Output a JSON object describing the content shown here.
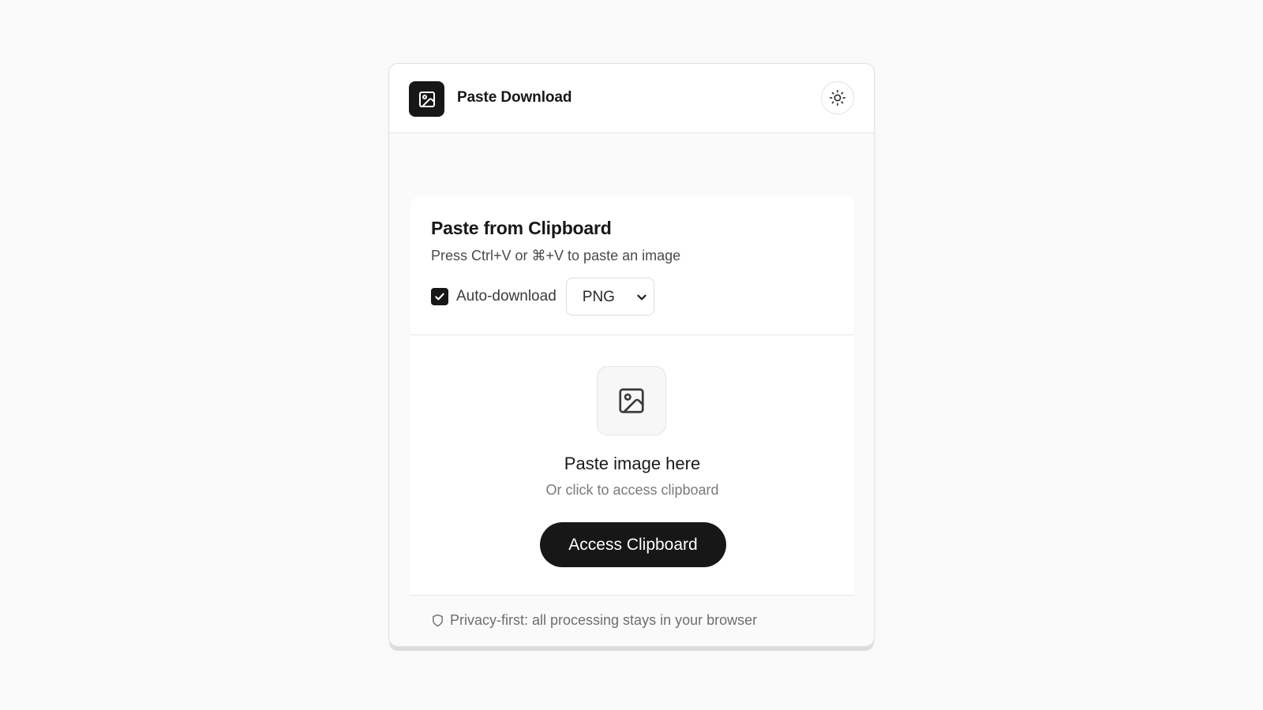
{
  "header": {
    "title": "Paste Download",
    "logo_icon": "image-icon",
    "theme_toggle_icon": "sun-icon"
  },
  "paste_card": {
    "title": "Paste from Clipboard",
    "subtitle": "Press Ctrl+V or ⌘+V to paste an image",
    "auto_download": {
      "label": "Auto-download",
      "checked": true
    },
    "format_select": {
      "value": "PNG"
    }
  },
  "drop_zone": {
    "icon": "image-icon",
    "title": "Paste image here",
    "subtitle": "Or click to access clipboard",
    "button_label": "Access Clipboard"
  },
  "footer": {
    "icon": "shield-icon",
    "text": "Privacy-first: all processing stays in your browser"
  },
  "colors": {
    "accent": "#171717",
    "background": "#f9f9f9",
    "card": "#ffffff",
    "muted_text": "#7a7a7a"
  }
}
